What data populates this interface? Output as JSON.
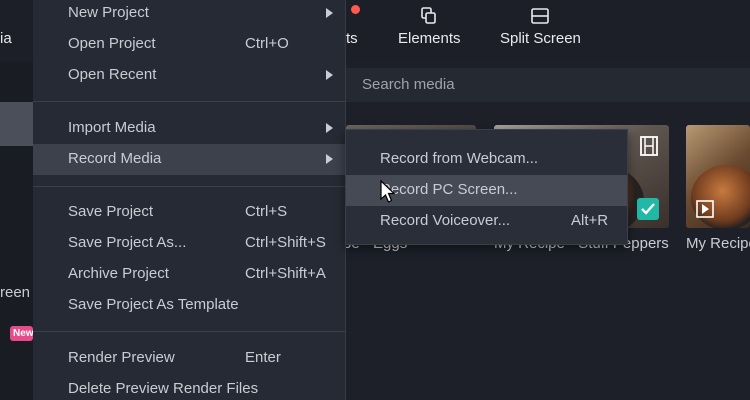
{
  "toolbar": {
    "media_tab_fragment": "ia",
    "effects_fragment": "ts",
    "elements_label": "Elements",
    "split_screen_label": "Split Screen",
    "notification_color": "#ff5a4e"
  },
  "sidebar": {
    "screen_fragment": "reen",
    "new_badge": "New"
  },
  "search": {
    "placeholder": "Search media"
  },
  "media_items": [
    {
      "label": "pe - Eggs"
    },
    {
      "label": "My Recipe - Stuff Peppers"
    },
    {
      "label": "My Recipe"
    }
  ],
  "file_menu": {
    "items": [
      {
        "label": "New Project",
        "shortcut": "",
        "submenu": true
      },
      {
        "label": "Open Project",
        "shortcut": "Ctrl+O",
        "submenu": false
      },
      {
        "label": "Open Recent",
        "shortcut": "",
        "submenu": true
      },
      {
        "label": "Import Media",
        "shortcut": "",
        "submenu": true
      },
      {
        "label": "Record Media",
        "shortcut": "",
        "submenu": true,
        "highlighted": true
      },
      {
        "label": "Save Project",
        "shortcut": "Ctrl+S",
        "submenu": false
      },
      {
        "label": "Save Project As...",
        "shortcut": "Ctrl+Shift+S",
        "submenu": false
      },
      {
        "label": "Archive Project",
        "shortcut": "Ctrl+Shift+A",
        "submenu": false
      },
      {
        "label": "Save Project As Template",
        "shortcut": "",
        "submenu": false
      },
      {
        "label": "Render Preview",
        "shortcut": "Enter",
        "submenu": false
      },
      {
        "label": "Delete Preview Render Files",
        "shortcut": "",
        "submenu": false
      }
    ]
  },
  "record_submenu": {
    "items": [
      {
        "label": "Record from Webcam...",
        "shortcut": ""
      },
      {
        "label": "Record PC Screen...",
        "shortcut": "",
        "hovered": true
      },
      {
        "label": "Record Voiceover...",
        "shortcut": "Alt+R"
      }
    ]
  },
  "colors": {
    "menu_bg": "#262a34",
    "highlight": "#3c414c",
    "accent_check": "#21b8a6",
    "new_badge": "#e64b8b"
  }
}
